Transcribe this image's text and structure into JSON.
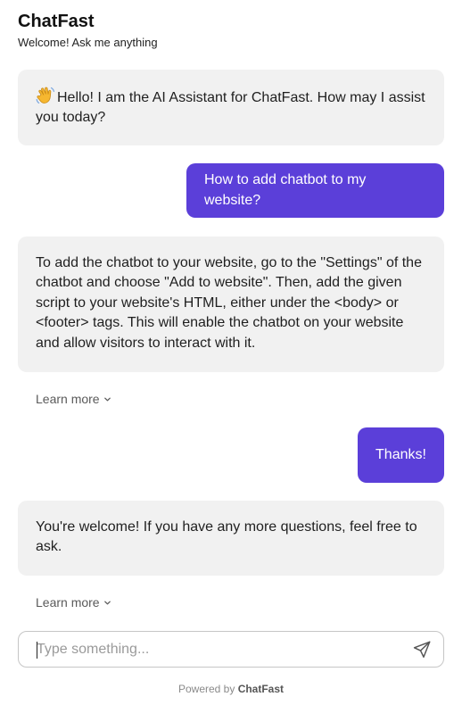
{
  "header": {
    "title": "ChatFast",
    "subtitle": "Welcome! Ask me anything"
  },
  "messages": [
    {
      "role": "bot",
      "icon": "waving-hand-icon",
      "text": "Hello! I am the AI Assistant for ChatFast. How may I assist you today?"
    },
    {
      "role": "user",
      "text": "How to add chatbot to my website?"
    },
    {
      "role": "bot",
      "text": "To add the chatbot to your website, go to the \"Settings\" of the chatbot and choose \"Add to website\". Then, add the given script to your website's HTML, either under the <body> or <footer> tags. This will enable the chatbot on your website and allow visitors to interact with it.",
      "learn_more": "Learn more"
    },
    {
      "role": "user",
      "text": "Thanks!"
    },
    {
      "role": "bot",
      "text": "You're welcome! If you have any more questions, feel free to ask.",
      "learn_more": "Learn more"
    }
  ],
  "composer": {
    "placeholder": "Type something...",
    "value": "",
    "send_icon": "send-icon"
  },
  "footer": {
    "prefix": "Powered by",
    "brand": "ChatFast"
  },
  "colors": {
    "accent": "#5b3fd9",
    "bot_bubble": "#f1f1f1"
  }
}
